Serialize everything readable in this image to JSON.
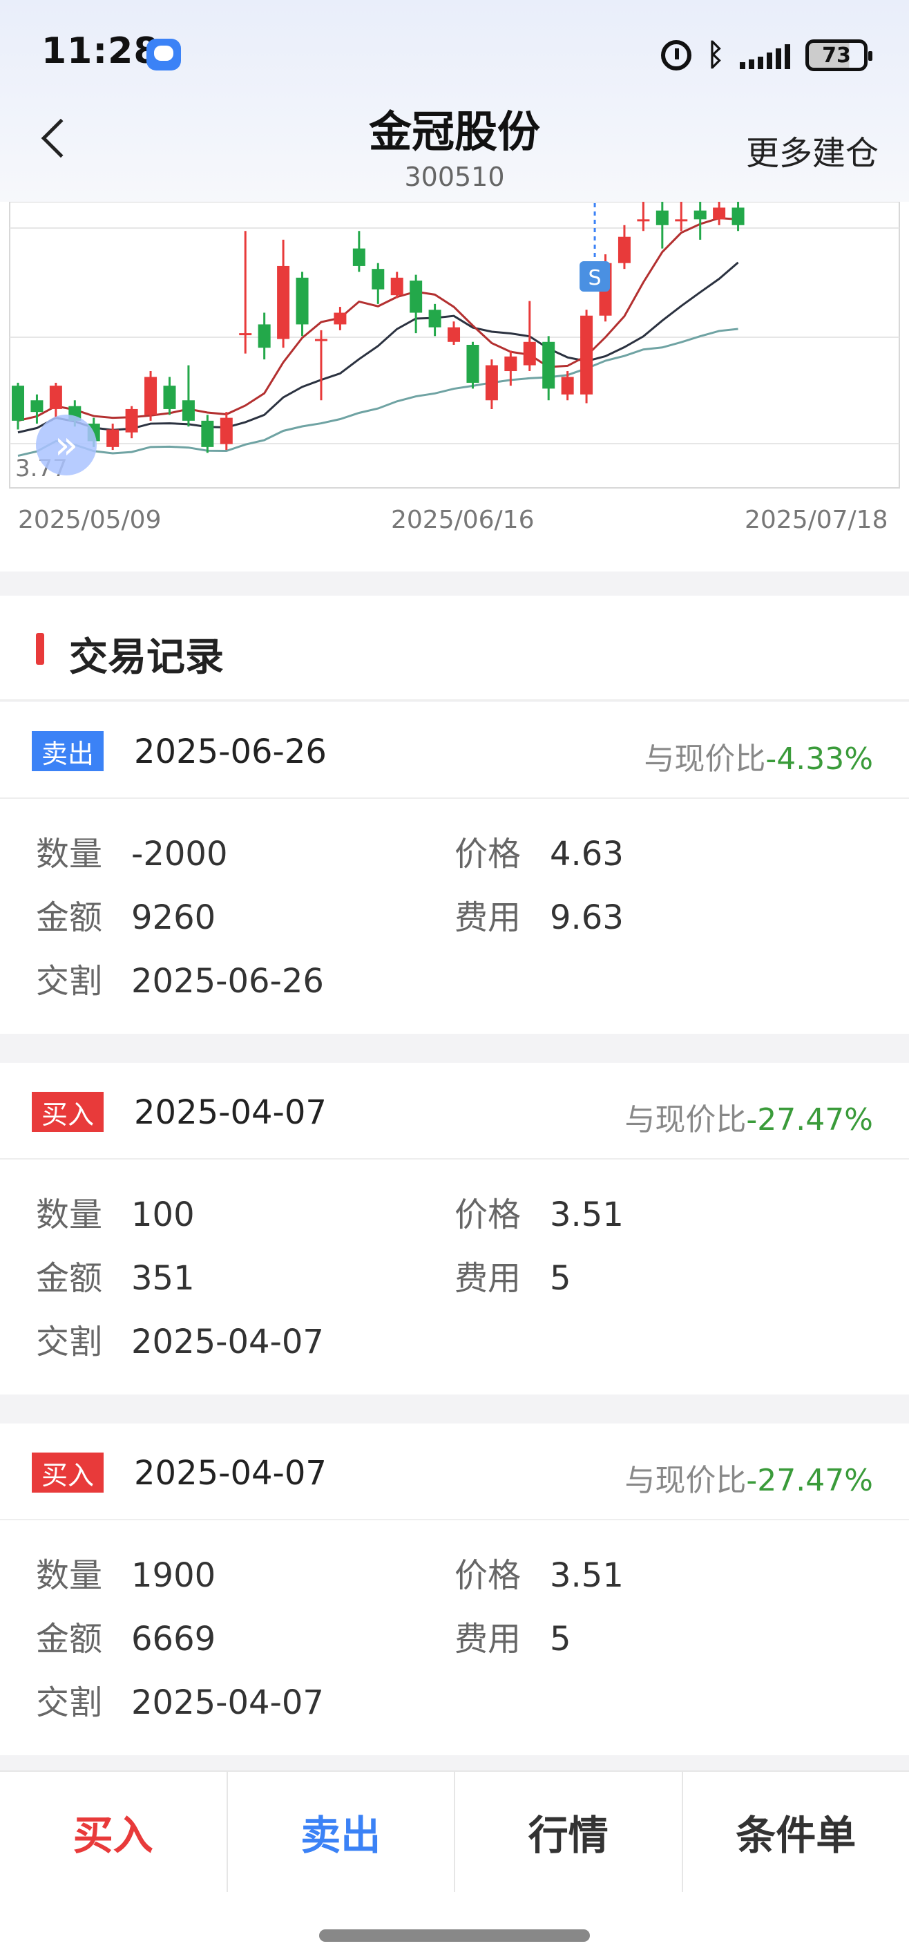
{
  "status_bar": {
    "time": "11:28",
    "battery": "73"
  },
  "header": {
    "title": "金冠股份",
    "code": "300510",
    "more_label": "更多建仓"
  },
  "chart": {
    "y_min_label": "3.77",
    "x_labels": [
      "2025/05/09",
      "2025/06/16",
      "2025/07/18"
    ],
    "marker_label": "S",
    "colors": {
      "up": "#e83a3a",
      "down": "#23a84a",
      "ma5": "#b33030",
      "ma10": "#2b3240",
      "ma20": "#6fa3a3"
    }
  },
  "chart_data": {
    "type": "candlestick",
    "x_range": [
      "2025/05/09",
      "2025/07/18"
    ],
    "y_min": 3.77,
    "candles": [
      {
        "o": 4.05,
        "c": 3.93,
        "h": 4.06,
        "l": 3.9
      },
      {
        "o": 4.0,
        "c": 3.96,
        "h": 4.02,
        "l": 3.92
      },
      {
        "o": 3.97,
        "c": 4.05,
        "h": 4.06,
        "l": 3.94
      },
      {
        "o": 3.98,
        "c": 3.93,
        "h": 4.0,
        "l": 3.91
      },
      {
        "o": 3.92,
        "c": 3.86,
        "h": 3.94,
        "l": 3.84
      },
      {
        "o": 3.84,
        "c": 3.9,
        "h": 3.92,
        "l": 3.83
      },
      {
        "o": 3.89,
        "c": 3.97,
        "h": 3.98,
        "l": 3.87
      },
      {
        "o": 3.95,
        "c": 4.08,
        "h": 4.1,
        "l": 3.93
      },
      {
        "o": 4.05,
        "c": 3.97,
        "h": 4.08,
        "l": 3.95
      },
      {
        "o": 4.0,
        "c": 3.93,
        "h": 4.12,
        "l": 3.91
      },
      {
        "o": 3.93,
        "c": 3.84,
        "h": 3.95,
        "l": 3.82
      },
      {
        "o": 3.85,
        "c": 3.94,
        "h": 3.96,
        "l": 3.83
      },
      {
        "o": 4.23,
        "c": 4.23,
        "h": 4.58,
        "l": 4.16
      },
      {
        "o": 4.26,
        "c": 4.18,
        "h": 4.3,
        "l": 4.14
      },
      {
        "o": 4.21,
        "c": 4.46,
        "h": 4.55,
        "l": 4.18
      },
      {
        "o": 4.42,
        "c": 4.26,
        "h": 4.44,
        "l": 4.22
      },
      {
        "o": 4.21,
        "c": 4.21,
        "h": 4.24,
        "l": 4.0
      },
      {
        "o": 4.26,
        "c": 4.3,
        "h": 4.32,
        "l": 4.24
      },
      {
        "o": 4.52,
        "c": 4.46,
        "h": 4.58,
        "l": 4.44
      },
      {
        "o": 4.45,
        "c": 4.38,
        "h": 4.47,
        "l": 4.33
      },
      {
        "o": 4.36,
        "c": 4.42,
        "h": 4.44,
        "l": 4.35
      },
      {
        "o": 4.41,
        "c": 4.3,
        "h": 4.43,
        "l": 4.23
      },
      {
        "o": 4.31,
        "c": 4.25,
        "h": 4.33,
        "l": 4.22
      },
      {
        "o": 4.2,
        "c": 4.25,
        "h": 4.27,
        "l": 4.19
      },
      {
        "o": 4.19,
        "c": 4.06,
        "h": 4.2,
        "l": 4.04
      },
      {
        "o": 4.0,
        "c": 4.12,
        "h": 4.14,
        "l": 3.97
      },
      {
        "o": 4.1,
        "c": 4.15,
        "h": 4.17,
        "l": 4.05
      },
      {
        "o": 4.12,
        "c": 4.2,
        "h": 4.34,
        "l": 4.1
      },
      {
        "o": 4.2,
        "c": 4.04,
        "h": 4.22,
        "l": 4.0
      },
      {
        "o": 4.02,
        "c": 4.08,
        "h": 4.1,
        "l": 4.0
      },
      {
        "o": 4.02,
        "c": 4.29,
        "h": 4.31,
        "l": 3.99
      },
      {
        "o": 4.29,
        "c": 4.47,
        "h": 4.5,
        "l": 4.27
      },
      {
        "o": 4.47,
        "c": 4.56,
        "h": 4.6,
        "l": 4.45
      },
      {
        "o": 4.62,
        "c": 4.62,
        "h": 4.68,
        "l": 4.58
      },
      {
        "o": 4.65,
        "c": 4.6,
        "h": 4.7,
        "l": 4.52
      },
      {
        "o": 4.62,
        "c": 4.62,
        "h": 4.75,
        "l": 4.58
      },
      {
        "o": 4.65,
        "c": 4.62,
        "h": 4.68,
        "l": 4.55
      },
      {
        "o": 4.62,
        "c": 4.66,
        "h": 4.7,
        "l": 4.6
      },
      {
        "o": 4.66,
        "c": 4.6,
        "h": 4.68,
        "l": 4.58
      }
    ],
    "trade_marker": {
      "type": "sell",
      "label": "S",
      "index": 30
    }
  },
  "section_title": "交易记录",
  "records": [
    {
      "type_label": "卖出",
      "type": "sell",
      "date": "2025-06-26",
      "compare_label": "与现价比",
      "compare_value": "-4.33%",
      "qty_label": "数量",
      "qty": "-2000",
      "price_label": "价格",
      "price": "4.63",
      "amount_label": "金额",
      "amount": "9260",
      "fee_label": "费用",
      "fee": "9.63",
      "settle_label": "交割",
      "settle": "2025-06-26"
    },
    {
      "type_label": "买入",
      "type": "buy",
      "date": "2025-04-07",
      "compare_label": "与现价比",
      "compare_value": "-27.47%",
      "qty_label": "数量",
      "qty": "100",
      "price_label": "价格",
      "price": "3.51",
      "amount_label": "金额",
      "amount": "351",
      "fee_label": "费用",
      "fee": "5",
      "settle_label": "交割",
      "settle": "2025-04-07"
    },
    {
      "type_label": "买入",
      "type": "buy",
      "date": "2025-04-07",
      "compare_label": "与现价比",
      "compare_value": "-27.47%",
      "qty_label": "数量",
      "qty": "1900",
      "price_label": "价格",
      "price": "3.51",
      "amount_label": "金额",
      "amount": "6669",
      "fee_label": "费用",
      "fee": "5",
      "settle_label": "交割",
      "settle": "2025-04-07"
    }
  ],
  "tabs": [
    {
      "label": "买入"
    },
    {
      "label": "卖出"
    },
    {
      "label": "行情"
    },
    {
      "label": "条件单"
    }
  ]
}
